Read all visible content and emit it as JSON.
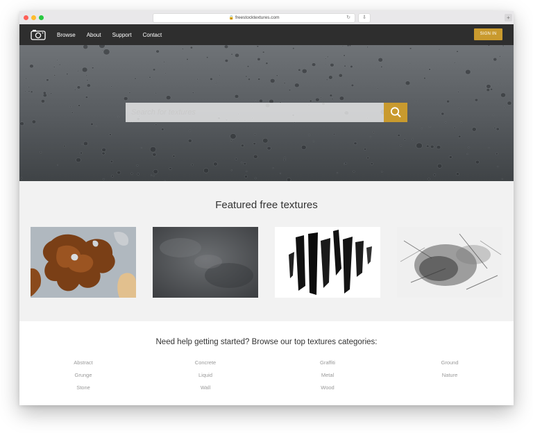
{
  "browser": {
    "url": "freestocktextures.com"
  },
  "nav": {
    "links": [
      "Browse",
      "About",
      "Support",
      "Contact"
    ],
    "signin_label": "SIGN IN"
  },
  "hero": {
    "search_placeholder": "Search for textures"
  },
  "featured": {
    "title": "Featured free textures",
    "thumbnails": [
      "rust-texture",
      "concrete-texture",
      "brush-stroke-texture",
      "grunge-texture"
    ]
  },
  "categories": {
    "title": "Need help getting started? Browse our top textures categories:",
    "items": [
      "Abstract",
      "Concrete",
      "Graffiti",
      "Ground",
      "Grunge",
      "Liquid",
      "Metal",
      "Nature",
      "Stone",
      "Wall",
      "Wood"
    ]
  },
  "colors": {
    "accent": "#c99a2e",
    "nav_bg": "#2e2e2e",
    "featured_bg": "#f2f2f2"
  }
}
